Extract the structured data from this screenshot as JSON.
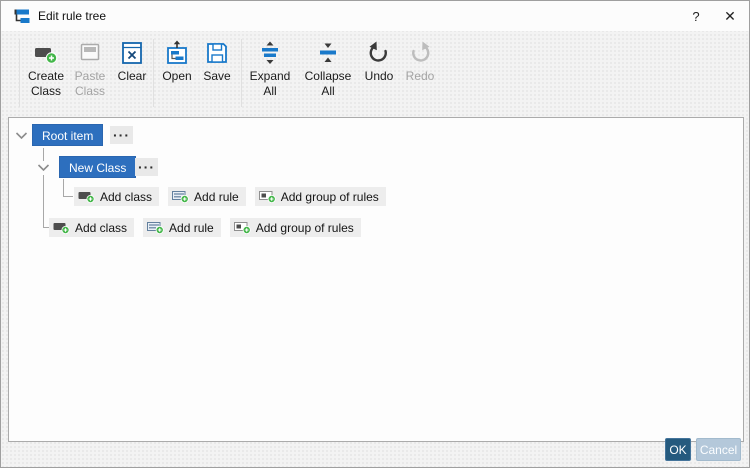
{
  "window": {
    "title": "Edit rule tree",
    "help_label": "?",
    "close_label": "✕"
  },
  "toolbar": {
    "buttons": [
      {
        "label": "Create Class",
        "icon": "create-class-icon",
        "enabled": true
      },
      {
        "label": "Paste Class",
        "icon": "paste-class-icon",
        "enabled": false
      },
      {
        "label": "Clear",
        "icon": "clear-icon",
        "enabled": true
      },
      {
        "label": "Open",
        "icon": "open-icon",
        "enabled": true
      },
      {
        "label": "Save",
        "icon": "save-icon",
        "enabled": true
      },
      {
        "label": "Expand All",
        "icon": "expand-all-icon",
        "enabled": true
      },
      {
        "label": "Collapse All",
        "icon": "collapse-all-icon",
        "enabled": true
      },
      {
        "label": "Undo",
        "icon": "undo-icon",
        "enabled": true
      },
      {
        "label": "Redo",
        "icon": "redo-icon",
        "enabled": false
      }
    ]
  },
  "tree": {
    "root": {
      "label": "Root item",
      "selected": true,
      "menu_ellipsis": "···"
    },
    "child": {
      "label": "New Class",
      "selected": true,
      "menu_ellipsis": "···"
    },
    "child_actions": [
      {
        "label": "Add class",
        "icon": "add-class-icon"
      },
      {
        "label": "Add rule",
        "icon": "add-rule-icon"
      },
      {
        "label": "Add group of rules",
        "icon": "add-group-of-rules-icon"
      }
    ],
    "root_actions": [
      {
        "label": "Add class",
        "icon": "add-class-icon"
      },
      {
        "label": "Add rule",
        "icon": "add-rule-icon"
      },
      {
        "label": "Add group of rules",
        "icon": "add-group-of-rules-icon"
      }
    ]
  },
  "footer": {
    "ok_label": "OK",
    "cancel_label": "Cancel",
    "cancel_enabled": false
  },
  "colors": {
    "selection_blue": "#2d6fbe",
    "icon_blue": "#1979ca",
    "add_green": "#43b649",
    "ok_button": "#255a7e",
    "cancel_button": "#b4c8da"
  }
}
